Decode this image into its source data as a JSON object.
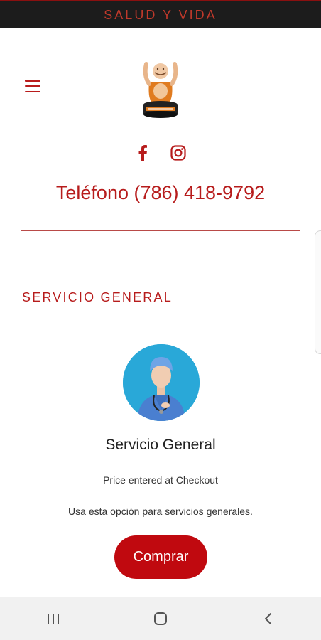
{
  "header": {
    "title": "SALUD Y VIDA"
  },
  "icons": {
    "menu": "hamburger-menu-icon",
    "facebook": "facebook-icon",
    "instagram": "instagram-icon",
    "recents": "recent-apps-icon",
    "home": "home-icon",
    "back": "back-icon"
  },
  "contact": {
    "phone": "Teléfono (786) 418-9792"
  },
  "section": {
    "title": "SERVICIO GENERAL"
  },
  "product": {
    "name": "Servicio General",
    "price_note": "Price entered at Checkout",
    "description": "Usa esta opción para servicios generales.",
    "buy_label": "Comprar"
  },
  "colors": {
    "accent": "#b71c1c",
    "button": "#c0090f",
    "topbar": "#1c1c1c"
  }
}
